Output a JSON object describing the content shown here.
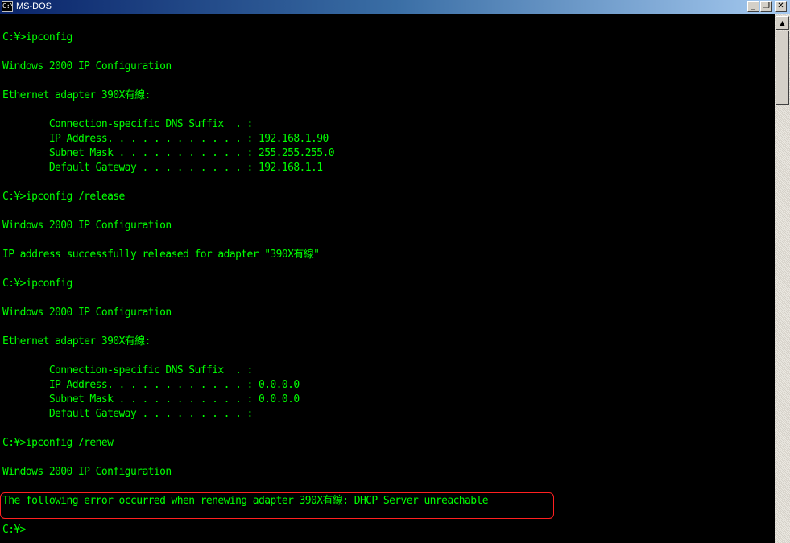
{
  "window": {
    "title": "MS-DOS",
    "icon": "C:\\",
    "minimize_label": "_",
    "maximize_label": "❐",
    "close_label": "✕"
  },
  "scrollbar": {
    "up_arrow": "▲"
  },
  "colors": {
    "console_bg": "#000000",
    "console_text": "#00ff00",
    "highlight": "#ff2020"
  },
  "console": {
    "lines": [
      "C:¥>ipconfig",
      "Windows 2000 IP Configuration",
      "Ethernet adapter 390X有線:",
      "        Connection-specific DNS Suffix  . :",
      "        IP Address. . . . . . . . . . . . : 192.168.1.90",
      "        Subnet Mask . . . . . . . . . . . : 255.255.255.0",
      "        Default Gateway . . . . . . . . . : 192.168.1.1",
      "C:¥>ipconfig /release",
      "Windows 2000 IP Configuration",
      "IP address successfully released for adapter \"390X有線\"",
      "C:¥>ipconfig",
      "Windows 2000 IP Configuration",
      "Ethernet adapter 390X有線:",
      "        Connection-specific DNS Suffix  . :",
      "        IP Address. . . . . . . . . . . . : 0.0.0.0",
      "        Subnet Mask . . . . . . . . . . . : 0.0.0.0",
      "        Default Gateway . . . . . . . . . :",
      "C:¥>ipconfig /renew",
      "Windows 2000 IP Configuration",
      "The following error occurred when renewing adapter 390X有線: DHCP Server unreachable",
      "C:¥>"
    ]
  }
}
